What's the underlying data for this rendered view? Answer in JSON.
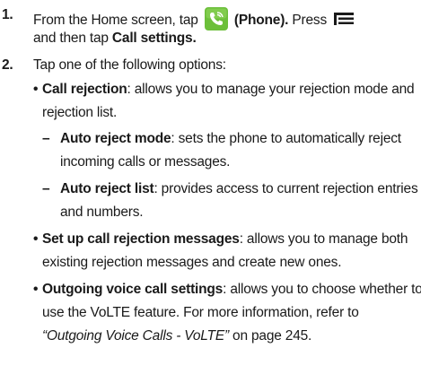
{
  "step1": {
    "number": "1.",
    "text_before_icon": "From the Home screen, tap",
    "phone_label": "(Phone).",
    "press_text": "Press",
    "line2_prefix": "and then tap",
    "call_settings": "Call settings."
  },
  "step2": {
    "number": "2.",
    "intro": "Tap one of the following options:",
    "call_rejection": {
      "bullet": "•",
      "label": "Call rejection",
      "desc_line1": ": allows you to manage your rejection mode and",
      "desc_line2": "rejection list."
    },
    "auto_reject_mode": {
      "dash": "–",
      "label": "Auto reject mode",
      "desc_line1": ": sets the phone to automatically reject",
      "desc_line2": "incoming calls or messages."
    },
    "auto_reject_list": {
      "dash": "–",
      "label": "Auto reject list",
      "desc_line1": ": provides access to current rejection entries",
      "desc_line2": "and numbers."
    },
    "setup_messages": {
      "bullet": "•",
      "label": "Set up call rejection messages",
      "desc_line1": ": allows you to manage both",
      "desc_line2": "existing rejection messages and create new ones."
    },
    "outgoing_voice": {
      "bullet": "•",
      "label": "Outgoing voice call settings",
      "desc_line1": ": allows you to choose whether to",
      "desc_line2": "use the VoLTE feature. For more information, refer to",
      "reference": "“Outgoing Voice Calls - VoLTE”",
      "page_ref": " on page 245."
    }
  },
  "colors": {
    "phone_icon_bg": "#6cbf3a",
    "text": "#1a1a1a"
  },
  "icons": {
    "phone": "phone-app-icon",
    "menu": "menu-key-icon"
  }
}
